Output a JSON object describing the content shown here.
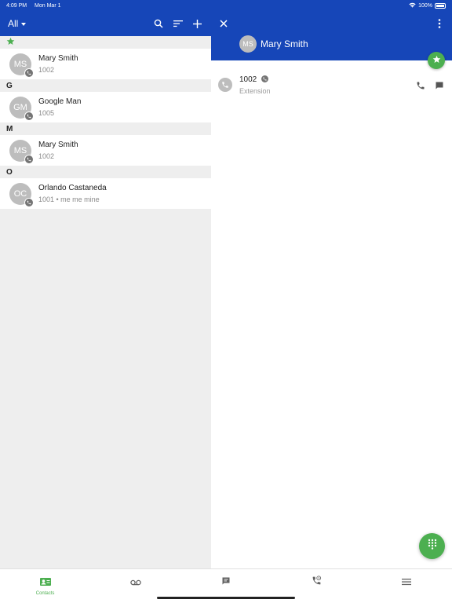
{
  "status_bar": {
    "time": "4:09 PM",
    "date": "Mon Mar 1",
    "battery": "100%"
  },
  "contacts_list": {
    "filter_label": "All",
    "sections": [
      {
        "header": "",
        "starred": true,
        "contacts": [
          {
            "initials": "MS",
            "name": "Mary Smith",
            "sub": "1002"
          }
        ]
      },
      {
        "header": "G",
        "starred": false,
        "contacts": [
          {
            "initials": "GM",
            "name": "Google Man",
            "sub": "1005"
          }
        ]
      },
      {
        "header": "M",
        "starred": false,
        "contacts": [
          {
            "initials": "MS",
            "name": "Mary Smith",
            "sub": "1002"
          }
        ]
      },
      {
        "header": "O",
        "starred": false,
        "contacts": [
          {
            "initials": "OC",
            "name": "Orlando Castaneda",
            "sub": "1001 • me me mine"
          }
        ]
      }
    ]
  },
  "detail": {
    "initials": "MS",
    "name": "Mary Smith",
    "extension_number": "1002",
    "extension_label": "Extension"
  },
  "bottom_nav": {
    "contacts_label": "Contacts"
  },
  "colors": {
    "brand": "#1646b8",
    "accent": "#4caf50"
  }
}
